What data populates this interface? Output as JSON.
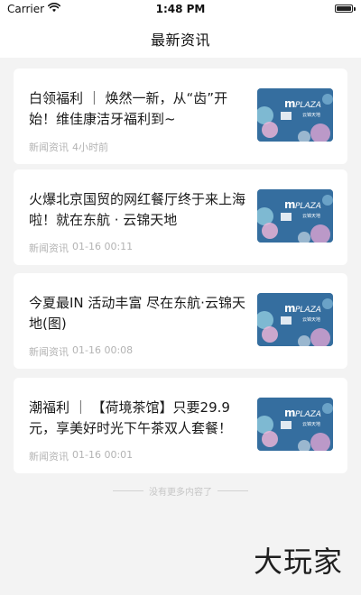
{
  "status_bar": {
    "carrier": "Carrier",
    "time": "1:48 PM",
    "wifi_icon": "wifi-icon",
    "battery_icon": "battery-icon"
  },
  "nav": {
    "title": "最新资讯"
  },
  "articles": [
    {
      "title": "白领福利 ｜ 焕然一新，从“齿”开始！维佳康洁牙福利到~",
      "category": "新闻资讯",
      "time": "4小时前",
      "thumb_brand": "PLAZA",
      "thumb_logo": "m",
      "thumb_sub": "云锦天地"
    },
    {
      "title": "火爆北京国贸的网红餐厅终于来上海啦！就在东航 · 云锦天地",
      "category": "新闻资讯",
      "time": "01-16 00:11",
      "thumb_brand": "PLAZA",
      "thumb_logo": "m",
      "thumb_sub": "云锦天地"
    },
    {
      "title": "今夏最IN 活动丰富 尽在东航·云锦天地(图)",
      "category": "新闻资讯",
      "time": "01-16 00:08",
      "thumb_brand": "PLAZA",
      "thumb_logo": "m",
      "thumb_sub": "云锦天地"
    },
    {
      "title": "潮福利 ｜ 【荷境茶馆】只要29.9元，享美好时光下午茶双人套餐！",
      "category": "新闻资讯",
      "time": "01-16 00:01",
      "thumb_brand": "PLAZA",
      "thumb_logo": "m",
      "thumb_sub": "云锦天地"
    }
  ],
  "footer": {
    "no_more": "没有更多内容了"
  },
  "watermark": "大玩家",
  "colors": {
    "background": "#f3f3f3",
    "card": "#ffffff",
    "title_text": "#1a1a1a",
    "meta_text": "#b3b3b3",
    "thumb_bg": "#2f5d8a"
  }
}
